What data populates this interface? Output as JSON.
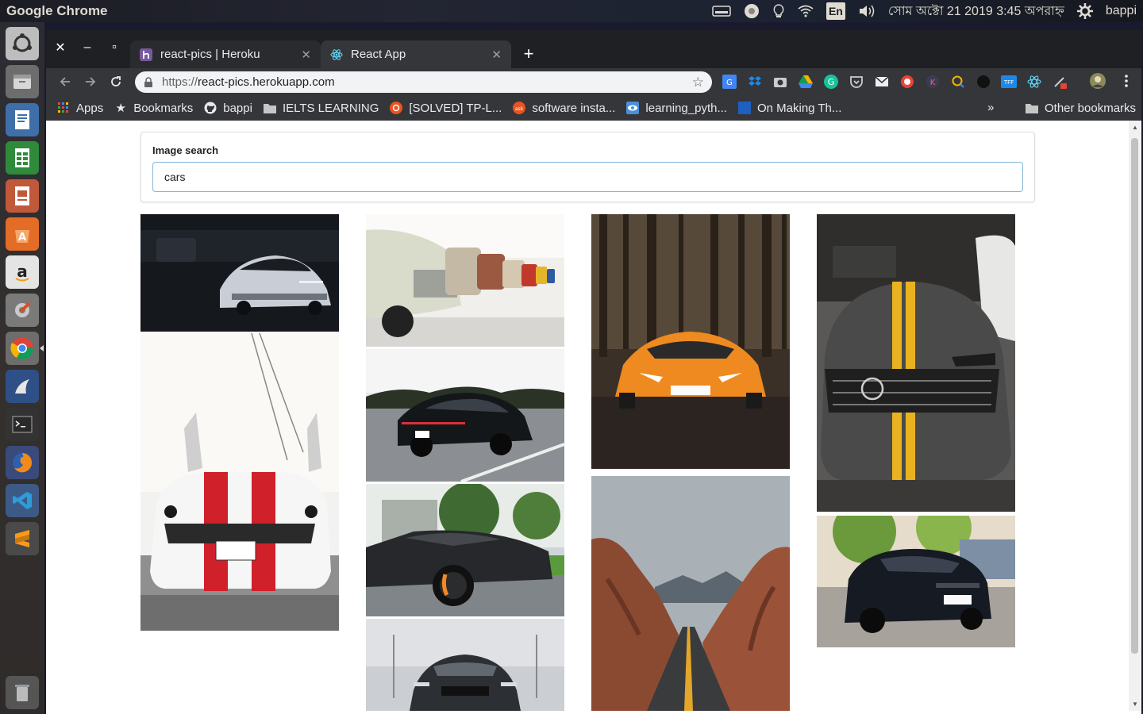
{
  "desktop": {
    "app_title": "Google Chrome",
    "lang": "En",
    "clock": "সোম অক্টো 21 2019  3:45 অপরাহ্ন",
    "username": "bappi"
  },
  "launcher": [
    {
      "name": "ubuntu-dash-icon"
    },
    {
      "name": "files-icon"
    },
    {
      "name": "writer-icon"
    },
    {
      "name": "calc-icon"
    },
    {
      "name": "impress-icon"
    },
    {
      "name": "software-center-icon"
    },
    {
      "name": "amazon-icon"
    },
    {
      "name": "system-settings-icon"
    },
    {
      "name": "chrome-icon"
    },
    {
      "name": "app-icon"
    },
    {
      "name": "terminal-icon"
    },
    {
      "name": "firefox-icon"
    },
    {
      "name": "vscode-icon"
    },
    {
      "name": "sublime-icon"
    },
    {
      "name": "trash-icon"
    }
  ],
  "tabs": [
    {
      "title": "react-pics | Heroku",
      "active": false
    },
    {
      "title": "React App",
      "active": true
    }
  ],
  "address": {
    "scheme": "https://",
    "host": "react-pics.herokuapp.com"
  },
  "bookmarks": [
    {
      "label": "Apps",
      "icon": "apps-grid-icon"
    },
    {
      "label": "Bookmarks",
      "icon": "star-icon"
    },
    {
      "label": "bappi",
      "icon": "github-icon"
    },
    {
      "label": "IELTS LEARNING",
      "icon": "folder-icon"
    },
    {
      "label": "[SOLVED] TP-L...",
      "icon": "ubuntu-icon"
    },
    {
      "label": "software insta...",
      "icon": "ask-icon"
    },
    {
      "label": "learning_pyth...",
      "icon": "eye-icon"
    },
    {
      "label": "On Making Th...",
      "icon": "square-icon"
    }
  ],
  "bookmarks_more": "»",
  "bookmarks_other": "Other bookmarks",
  "search": {
    "label": "Image search",
    "value": "cars"
  },
  "images": [
    {
      "name": "dark-camaro-image",
      "desc": "white sports car in dark garage"
    },
    {
      "name": "white-mustang-image",
      "desc": "white mustang with red stripes, doors open"
    },
    {
      "name": "classic-cars-row-image",
      "desc": "row of classic cars in showroom"
    },
    {
      "name": "black-porsche-image",
      "desc": "black porsche on road"
    },
    {
      "name": "black-lamborghini-image",
      "desc": "black lamborghini side view"
    },
    {
      "name": "black-mustang-front-image",
      "desc": "black mustang front view"
    },
    {
      "name": "orange-lamborghini-image",
      "desc": "orange lamborghini in forest"
    },
    {
      "name": "desert-road-image",
      "desc": "desert road with red rocks"
    },
    {
      "name": "grey-mercedes-image",
      "desc": "grey mercedes with yellow stripe"
    },
    {
      "name": "black-mustang-street-image",
      "desc": "black mustang parked on street"
    }
  ],
  "colors": {
    "tabstrip": "#1f2023",
    "toolbar": "#35363a",
    "input_border": "#85b7d9"
  }
}
